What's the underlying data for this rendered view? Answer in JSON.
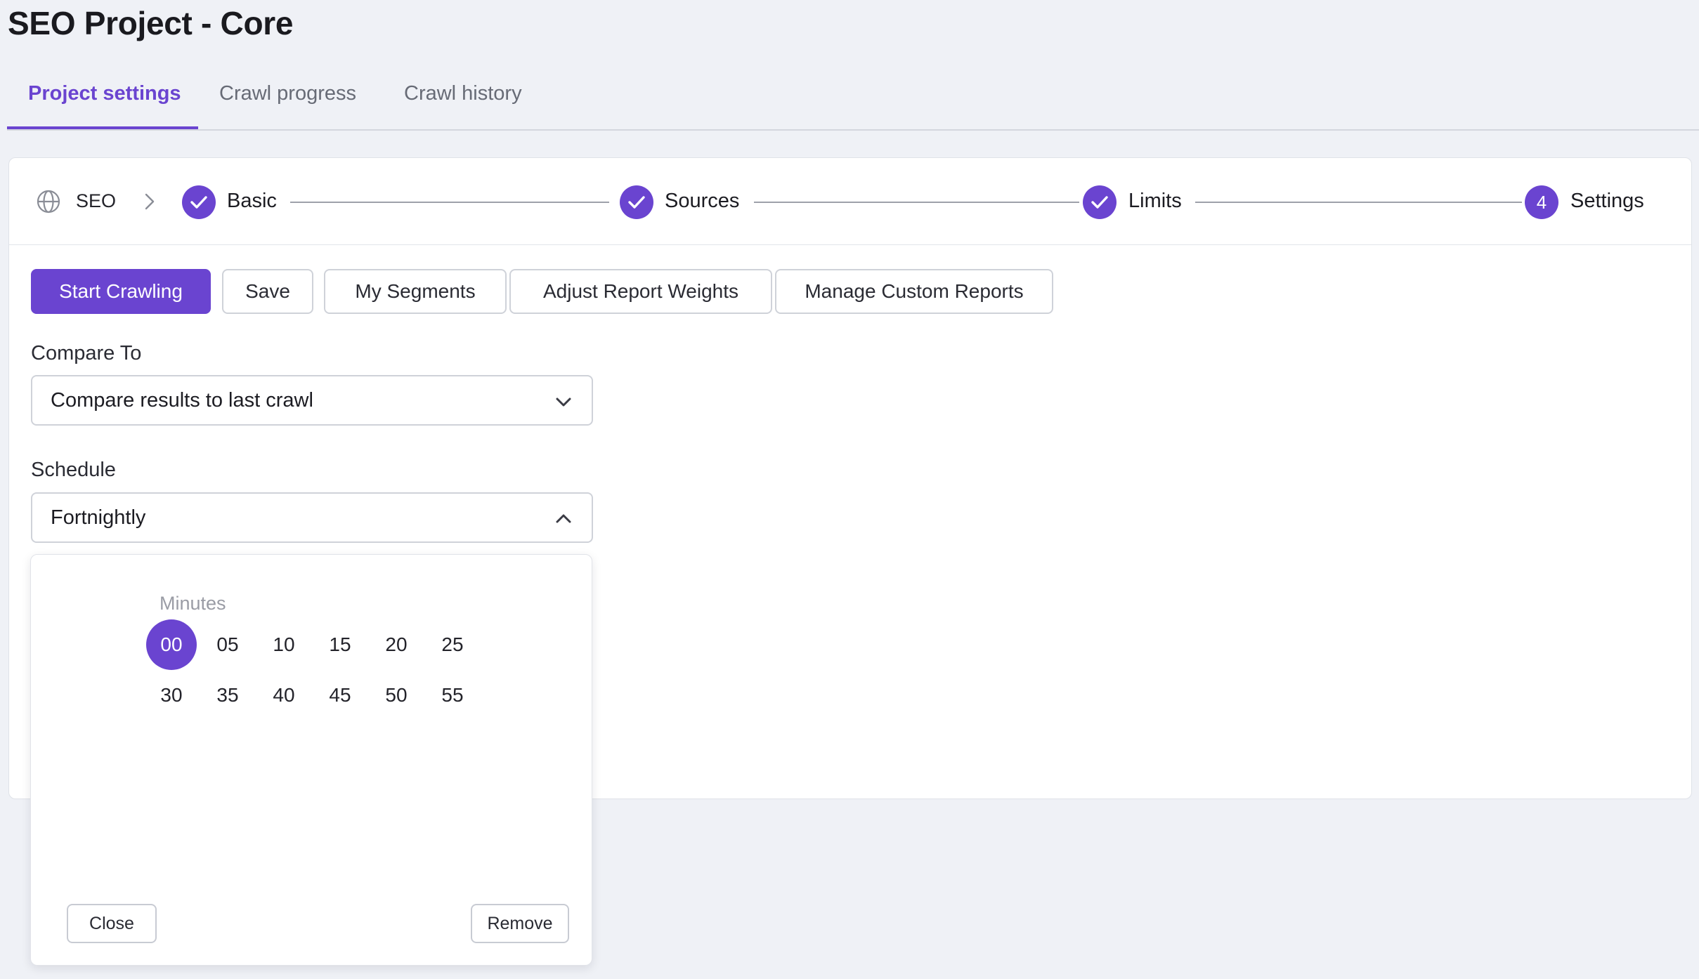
{
  "page": {
    "title": "SEO Project - Core"
  },
  "tabs": [
    {
      "label": "Project settings",
      "active": true
    },
    {
      "label": "Crawl progress",
      "active": false
    },
    {
      "label": "Crawl history",
      "active": false
    }
  ],
  "stepper": {
    "root_label": "SEO",
    "root_icon": "globe-icon",
    "steps": [
      {
        "label": "Basic",
        "state": "complete"
      },
      {
        "label": "Sources",
        "state": "complete"
      },
      {
        "label": "Limits",
        "state": "complete"
      },
      {
        "label": "Settings",
        "state": "current",
        "number": "4"
      }
    ]
  },
  "toolbar": {
    "start_crawling": "Start Crawling",
    "save": "Save",
    "my_segments": "My Segments",
    "adjust_report_weights": "Adjust Report Weights",
    "manage_custom_reports": "Manage Custom Reports"
  },
  "compare_to": {
    "label": "Compare To",
    "value": "Compare results to last crawl"
  },
  "schedule": {
    "label": "Schedule",
    "value": "Fortnightly",
    "expanded": true
  },
  "minutes_picker": {
    "label": "Minutes",
    "options": [
      "00",
      "05",
      "10",
      "15",
      "20",
      "25",
      "30",
      "35",
      "40",
      "45",
      "50",
      "55"
    ],
    "selected": "00",
    "close_label": "Close",
    "remove_label": "Remove"
  },
  "colors": {
    "accent": "#6a44d0",
    "background": "#eff1f6",
    "card": "#ffffff",
    "border": "#cfd2d9",
    "muted_text": "#676b76"
  }
}
